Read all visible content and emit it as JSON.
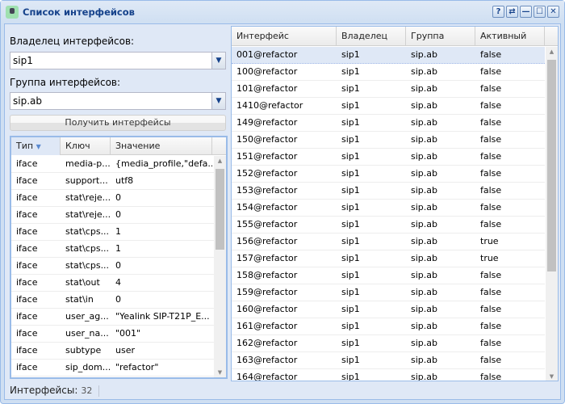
{
  "window": {
    "title": "Список интерфейсов",
    "tools": [
      "?",
      "⇄",
      "—",
      "☐",
      "✕"
    ]
  },
  "owner": {
    "label": "Владелец интерфейсов:",
    "value": "sip1"
  },
  "group": {
    "label": "Группа интерфейсов:",
    "value": "sip.ab"
  },
  "get_button": "Получить интерфейсы",
  "props_grid": {
    "columns": [
      "Тип",
      "Ключ",
      "Значение"
    ],
    "rows": [
      [
        "iface",
        "media-p...",
        "{media_profile,\"defa..."
      ],
      [
        "iface",
        "support...",
        "utf8"
      ],
      [
        "iface",
        "stat\\reje...",
        "0"
      ],
      [
        "iface",
        "stat\\reje...",
        "0"
      ],
      [
        "iface",
        "stat\\cps...",
        "1"
      ],
      [
        "iface",
        "stat\\cps...",
        "1"
      ],
      [
        "iface",
        "stat\\cps...",
        "0"
      ],
      [
        "iface",
        "stat\\out",
        "4"
      ],
      [
        "iface",
        "stat\\in",
        "0"
      ],
      [
        "iface",
        "user_ag...",
        "\"Yealink SIP-T21P_E..."
      ],
      [
        "iface",
        "user_na...",
        "\"001\""
      ],
      [
        "iface",
        "subtype",
        "user"
      ],
      [
        "iface",
        "sip_dom...",
        "\"refactor\""
      ]
    ]
  },
  "ifaces_grid": {
    "columns": [
      "Интерфейс",
      "Владелец",
      "Группа",
      "Активный"
    ],
    "rows": [
      [
        "001@refactor",
        "sip1",
        "sip.ab",
        "false"
      ],
      [
        "100@refactor",
        "sip1",
        "sip.ab",
        "false"
      ],
      [
        "101@refactor",
        "sip1",
        "sip.ab",
        "false"
      ],
      [
        "1410@refactor",
        "sip1",
        "sip.ab",
        "false"
      ],
      [
        "149@refactor",
        "sip1",
        "sip.ab",
        "false"
      ],
      [
        "150@refactor",
        "sip1",
        "sip.ab",
        "false"
      ],
      [
        "151@refactor",
        "sip1",
        "sip.ab",
        "false"
      ],
      [
        "152@refactor",
        "sip1",
        "sip.ab",
        "false"
      ],
      [
        "153@refactor",
        "sip1",
        "sip.ab",
        "false"
      ],
      [
        "154@refactor",
        "sip1",
        "sip.ab",
        "false"
      ],
      [
        "155@refactor",
        "sip1",
        "sip.ab",
        "false"
      ],
      [
        "156@refactor",
        "sip1",
        "sip.ab",
        "true"
      ],
      [
        "157@refactor",
        "sip1",
        "sip.ab",
        "true"
      ],
      [
        "158@refactor",
        "sip1",
        "sip.ab",
        "false"
      ],
      [
        "159@refactor",
        "sip1",
        "sip.ab",
        "false"
      ],
      [
        "160@refactor",
        "sip1",
        "sip.ab",
        "false"
      ],
      [
        "161@refactor",
        "sip1",
        "sip.ab",
        "false"
      ],
      [
        "162@refactor",
        "sip1",
        "sip.ab",
        "false"
      ],
      [
        "163@refactor",
        "sip1",
        "sip.ab",
        "false"
      ],
      [
        "164@refactor",
        "sip1",
        "sip.ab",
        "false"
      ]
    ]
  },
  "status": {
    "label": "Интерфейсы:",
    "count": "32"
  }
}
